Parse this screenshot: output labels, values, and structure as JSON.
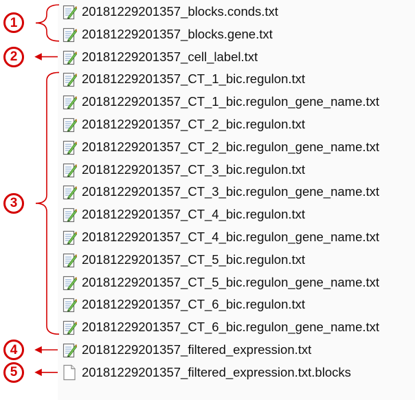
{
  "files": [
    {
      "name": "20181229201357_blocks.conds.txt",
      "icon": "text-file-edit-icon"
    },
    {
      "name": "20181229201357_blocks.gene.txt",
      "icon": "text-file-edit-icon"
    },
    {
      "name": "20181229201357_cell_label.txt",
      "icon": "text-file-edit-icon"
    },
    {
      "name": "20181229201357_CT_1_bic.regulon.txt",
      "icon": "text-file-edit-icon"
    },
    {
      "name": "20181229201357_CT_1_bic.regulon_gene_name.txt",
      "icon": "text-file-edit-icon"
    },
    {
      "name": "20181229201357_CT_2_bic.regulon.txt",
      "icon": "text-file-edit-icon"
    },
    {
      "name": "20181229201357_CT_2_bic.regulon_gene_name.txt",
      "icon": "text-file-edit-icon"
    },
    {
      "name": "20181229201357_CT_3_bic.regulon.txt",
      "icon": "text-file-edit-icon"
    },
    {
      "name": "20181229201357_CT_3_bic.regulon_gene_name.txt",
      "icon": "text-file-edit-icon"
    },
    {
      "name": "20181229201357_CT_4_bic.regulon.txt",
      "icon": "text-file-edit-icon"
    },
    {
      "name": "20181229201357_CT_4_bic.regulon_gene_name.txt",
      "icon": "text-file-edit-icon"
    },
    {
      "name": "20181229201357_CT_5_bic.regulon.txt",
      "icon": "text-file-edit-icon"
    },
    {
      "name": "20181229201357_CT_5_bic.regulon_gene_name.txt",
      "icon": "text-file-edit-icon"
    },
    {
      "name": "20181229201357_CT_6_bic.regulon.txt",
      "icon": "text-file-edit-icon"
    },
    {
      "name": "20181229201357_CT_6_bic.regulon_gene_name.txt",
      "icon": "text-file-edit-icon"
    },
    {
      "name": "20181229201357_filtered_expression.txt",
      "icon": "text-file-edit-icon"
    },
    {
      "name": "20181229201357_filtered_expression.txt.blocks",
      "icon": "blank-file-icon"
    }
  ],
  "annotations": [
    {
      "label": "1",
      "first_file": 1,
      "last_file": 2,
      "pointer": "brace"
    },
    {
      "label": "2",
      "first_file": 3,
      "last_file": 3,
      "pointer": "arrow"
    },
    {
      "label": "3",
      "first_file": 4,
      "last_file": 15,
      "pointer": "brace"
    },
    {
      "label": "4",
      "first_file": 16,
      "last_file": 16,
      "pointer": "arrow"
    },
    {
      "label": "5",
      "first_file": 17,
      "last_file": 17,
      "pointer": "arrow"
    }
  ],
  "colors": {
    "annotation": "#d40000",
    "panel": "#fafafa",
    "text": "#111111"
  }
}
